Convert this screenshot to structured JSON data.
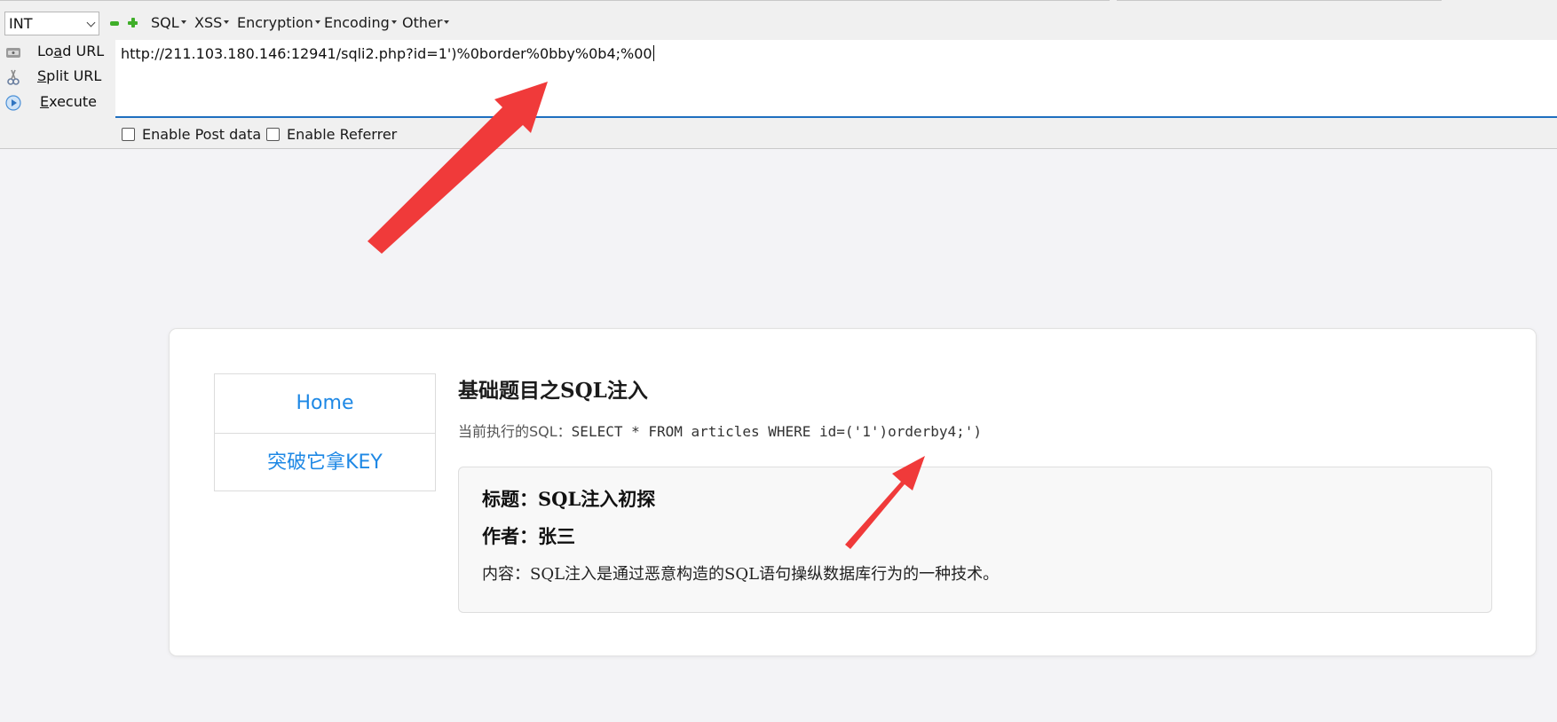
{
  "hackbar": {
    "select_value": "INT",
    "menu": [
      "SQL",
      "XSS",
      "Encryption",
      "Encoding",
      "Other"
    ],
    "side_buttons": [
      {
        "pre": "Lo",
        "ul": "a",
        "post": "d URL"
      },
      {
        "pre": "",
        "ul": "S",
        "post": "plit URL"
      },
      {
        "pre": "",
        "ul": "E",
        "post": "xecute"
      }
    ],
    "url": "http://211.103.180.146:12941/sqli2.php?id=1')%0border%0bby%0b4;%00",
    "enable_post": "Enable Post data",
    "enable_referrer": "Enable Referrer"
  },
  "page": {
    "nav": [
      "Home",
      "突破它拿KEY"
    ],
    "title": "基础题目之SQL注入",
    "sql_label": "当前执行的SQL：",
    "sql_query": "SELECT * FROM articles WHERE id=('1')orderby4;')",
    "article": {
      "title": "标题：SQL注入初探",
      "author": "作者：张三",
      "content": "内容：SQL注入是通过恶意构造的SQL语句操纵数据库行为的一种技术。"
    }
  },
  "colors": {
    "accent_blue": "#1e88e5",
    "url_underline": "#1f6fbf",
    "arrow_red": "#f03a3a",
    "green_icon": "#3fae29"
  },
  "icons": [
    "load-url-icon",
    "split-url-icon",
    "execute-icon",
    "minus-icon",
    "plus-icon"
  ]
}
